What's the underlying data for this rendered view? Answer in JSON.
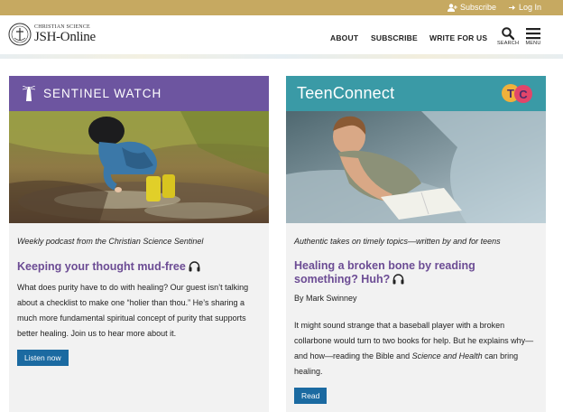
{
  "topbar": {
    "subscribe_label": "Subscribe",
    "login_label": "Log In",
    "background": "#c6a961"
  },
  "header": {
    "logo_small": "CHRISTIAN SCIENCE",
    "logo_big": "JSH-Online",
    "nav": [
      "ABOUT",
      "SUBSCRIBE",
      "WRITE FOR US"
    ],
    "search_caption": "SEARCH",
    "menu_caption": "MENU"
  },
  "cards": [
    {
      "title": "SENTINEL WATCH",
      "header_color": "#6d55a0",
      "icon": "lighthouse-icon",
      "image": "child-in-mud-puddle",
      "tagline": "Weekly podcast from the Christian Science Sentinel",
      "headline": "Keeping your thought mud-free",
      "body": "What does purity have to do with healing? Our guest isn’t talking about a checklist to make one “holier than thou.” He’s sharing a much more fundamental spiritual concept of purity that supports better healing. Join us to hear more about it.",
      "button": "Listen now"
    },
    {
      "title": "TeenConnect",
      "header_color": "#3a9aa6",
      "badge": "TC",
      "image": "teen-reading-on-bed",
      "tagline": "Authentic takes on timely topics—written by and for teens",
      "headline": "Healing a broken bone by reading something? Huh?",
      "byline": "By Mark Swinney",
      "body_before": "It might sound strange that a baseball player with a broken collarbone would turn to two books for help. But he explains why—and how—reading the Bible and ",
      "body_italic": "Science and Health",
      "body_after": " can bring healing.",
      "button": "Read"
    }
  ]
}
